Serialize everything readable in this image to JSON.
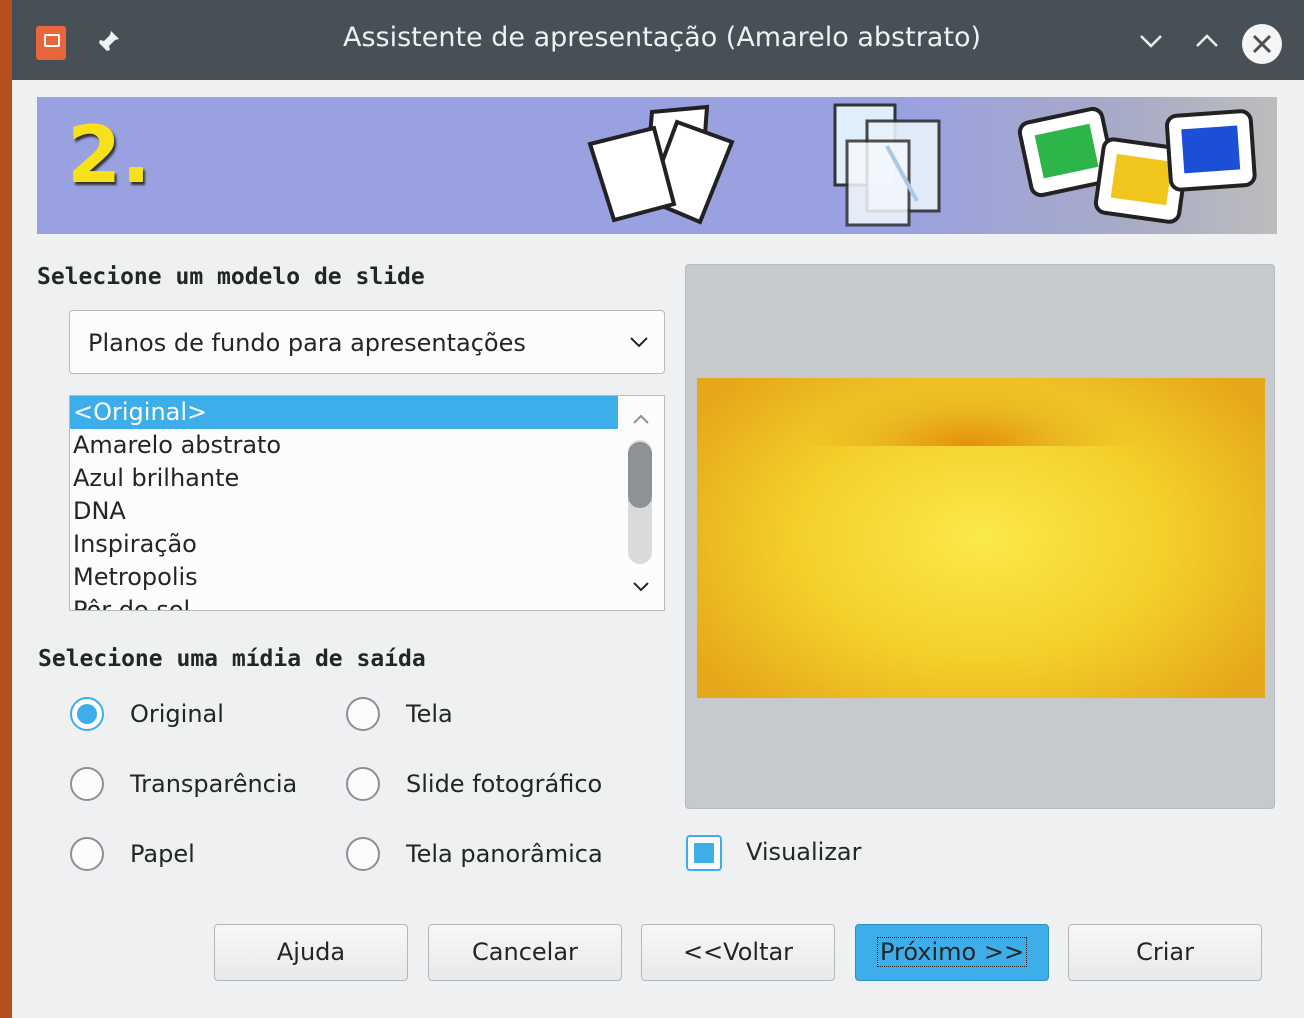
{
  "window": {
    "title": "Assistente de apresentação (Amarelo abstrato)"
  },
  "banner": {
    "step_number": "2."
  },
  "template_section": {
    "label": "Selecione um modelo de slide",
    "category_select": {
      "value": "Planos de fundo para apresentações"
    },
    "templates": [
      {
        "label": "<Original>",
        "selected": true
      },
      {
        "label": "Amarelo abstrato",
        "selected": false
      },
      {
        "label": "Azul brilhante",
        "selected": false
      },
      {
        "label": "DNA",
        "selected": false
      },
      {
        "label": "Inspiração",
        "selected": false
      },
      {
        "label": "Metropolis",
        "selected": false
      },
      {
        "label": "Pôr do sol",
        "selected": false
      }
    ]
  },
  "output_section": {
    "label": "Selecione uma mídia de saída",
    "options": [
      {
        "label": "Original",
        "checked": true
      },
      {
        "label": "Tela",
        "checked": false
      },
      {
        "label": "Transparência",
        "checked": false
      },
      {
        "label": "Slide fotográfico",
        "checked": false
      },
      {
        "label": "Papel",
        "checked": false
      },
      {
        "label": "Tela panorâmica",
        "checked": false
      }
    ]
  },
  "preview": {
    "checkbox_label": "Visualizar",
    "checked": true
  },
  "buttons": {
    "help": "Ajuda",
    "cancel": "Cancelar",
    "back": "<<Voltar",
    "next": "Próximo >>",
    "create": "Criar"
  },
  "colors": {
    "accent": "#3daee9",
    "titlebar": "#475057",
    "desktop": "#b5501e"
  }
}
